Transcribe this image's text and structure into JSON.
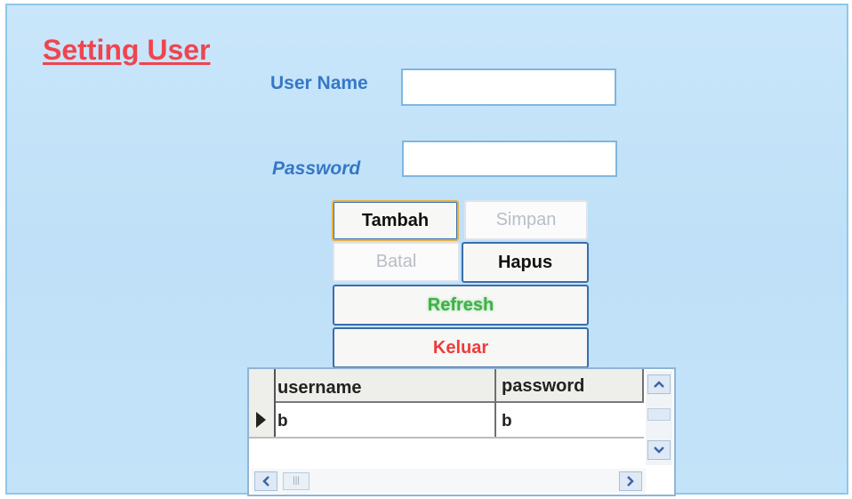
{
  "title": "Setting User",
  "form": {
    "username_label": "User Name",
    "password_label": "Password",
    "username_value": "",
    "password_value": ""
  },
  "buttons": {
    "tambah": "Tambah",
    "simpan": "Simpan",
    "batal": "Batal",
    "hapus": "Hapus",
    "refresh": "Refresh",
    "keluar": "Keluar"
  },
  "grid": {
    "columns": [
      "username",
      "password"
    ],
    "rows": [
      {
        "username": "b",
        "password": "b"
      }
    ]
  },
  "colors": {
    "title": "#f0444f",
    "label": "#3578c6",
    "refresh": "#3fb049",
    "keluar": "#ef3b3b",
    "background": "#c9e6fa"
  },
  "icons": {
    "row_indicator": "triangle-right-icon",
    "scroll_up": "chevron-up-icon",
    "scroll_down": "chevron-down-icon",
    "scroll_left": "chevron-left-icon",
    "scroll_right": "chevron-right-icon"
  }
}
